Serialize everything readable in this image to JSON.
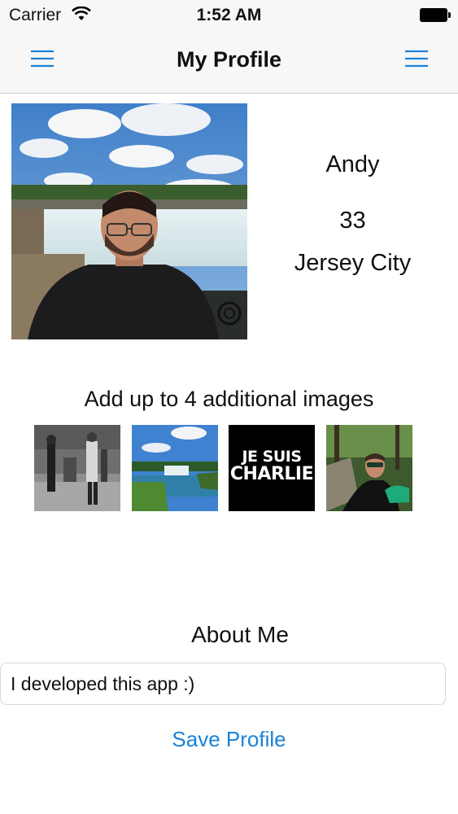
{
  "status_bar": {
    "carrier": "Carrier",
    "time": "1:52 AM"
  },
  "nav": {
    "title": "My Profile",
    "left_icon": "hamburger-menu-icon",
    "right_icon": "hamburger-menu-icon",
    "accent_color": "#1a82d8"
  },
  "profile": {
    "name": "Andy",
    "age": "33",
    "city": "Jersey City"
  },
  "additional_images": {
    "title": "Add up to 4 additional images",
    "thumbnails": [
      {
        "subject": "black-and-white-street-photo"
      },
      {
        "subject": "waterfall-river-photo"
      },
      {
        "subject": "je-suis-charlie-graphic",
        "line1": "JE SUIS",
        "line2": "CHARLIE"
      },
      {
        "subject": "man-in-forest-photo"
      }
    ]
  },
  "about": {
    "title": "About Me",
    "value": "I developed this app :)"
  },
  "actions": {
    "save_label": "Save Profile"
  }
}
